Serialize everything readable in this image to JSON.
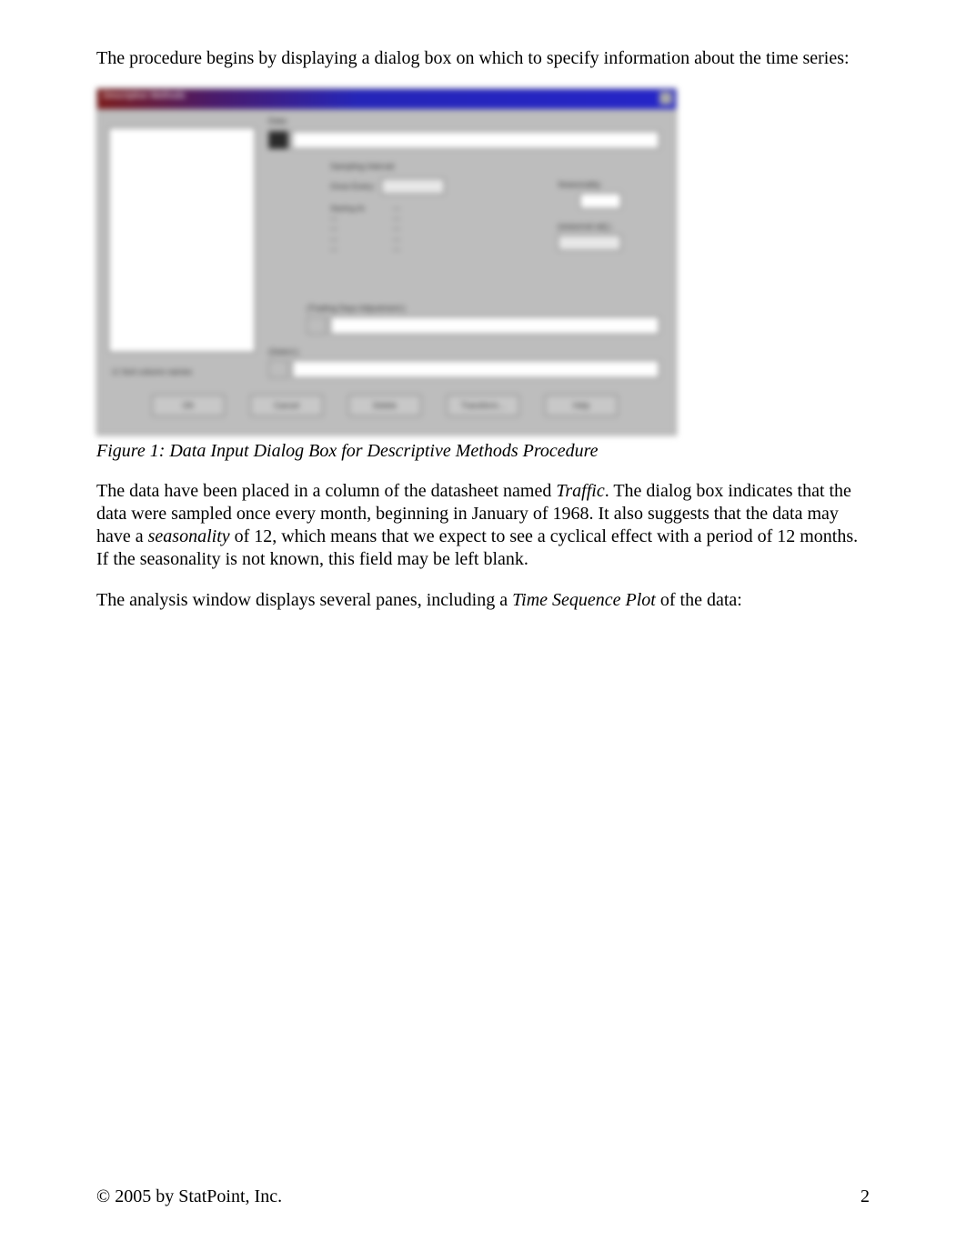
{
  "body": {
    "intro_para": "The procedure begins by displaying a dialog box on which to specify information about the time series:",
    "figure_caption": "Figure 1: Data Input Dialog Box for Descriptive Methods Procedure",
    "para2_part1": "The data have been placed in a column of the datasheet named ",
    "para2_italic1": "Traffic",
    "para2_part2": ". The dialog box indicates that the data were sampled once every month, beginning in January of 1968. It also suggests that the data may have a ",
    "para2_italic2": "seasonality",
    "para2_part3": " of 12, which means that we expect to see a cyclical effect with a period of 12 months. If the seasonality is not known, this field may be left blank.",
    "para3_part1": "The analysis window displays several panes, including a ",
    "para3_italic1": "Time Sequence Plot",
    "para3_part2": " of the data:"
  },
  "dialog": {
    "title": "Descriptive Methods",
    "left_label": " ",
    "data_label": "Data:",
    "sampling_label": "Sampling Interval:",
    "once_label": "Once Every:",
    "starting_heading": "Starting At:",
    "seasonality_label": "Seasonality:",
    "adjust_label": "(seasonal adj.)",
    "trading_label": "(Trading Days Adjustment:)",
    "select_label": "(Select:)",
    "sort_label": "Sort column names",
    "buttons": {
      "ok": "OK",
      "cancel": "Cancel",
      "delete": "Delete",
      "transform": "Transform...",
      "help": "Help"
    }
  },
  "footer": {
    "copyright": "© 2005 by StatPoint, Inc.",
    "page": "2"
  }
}
